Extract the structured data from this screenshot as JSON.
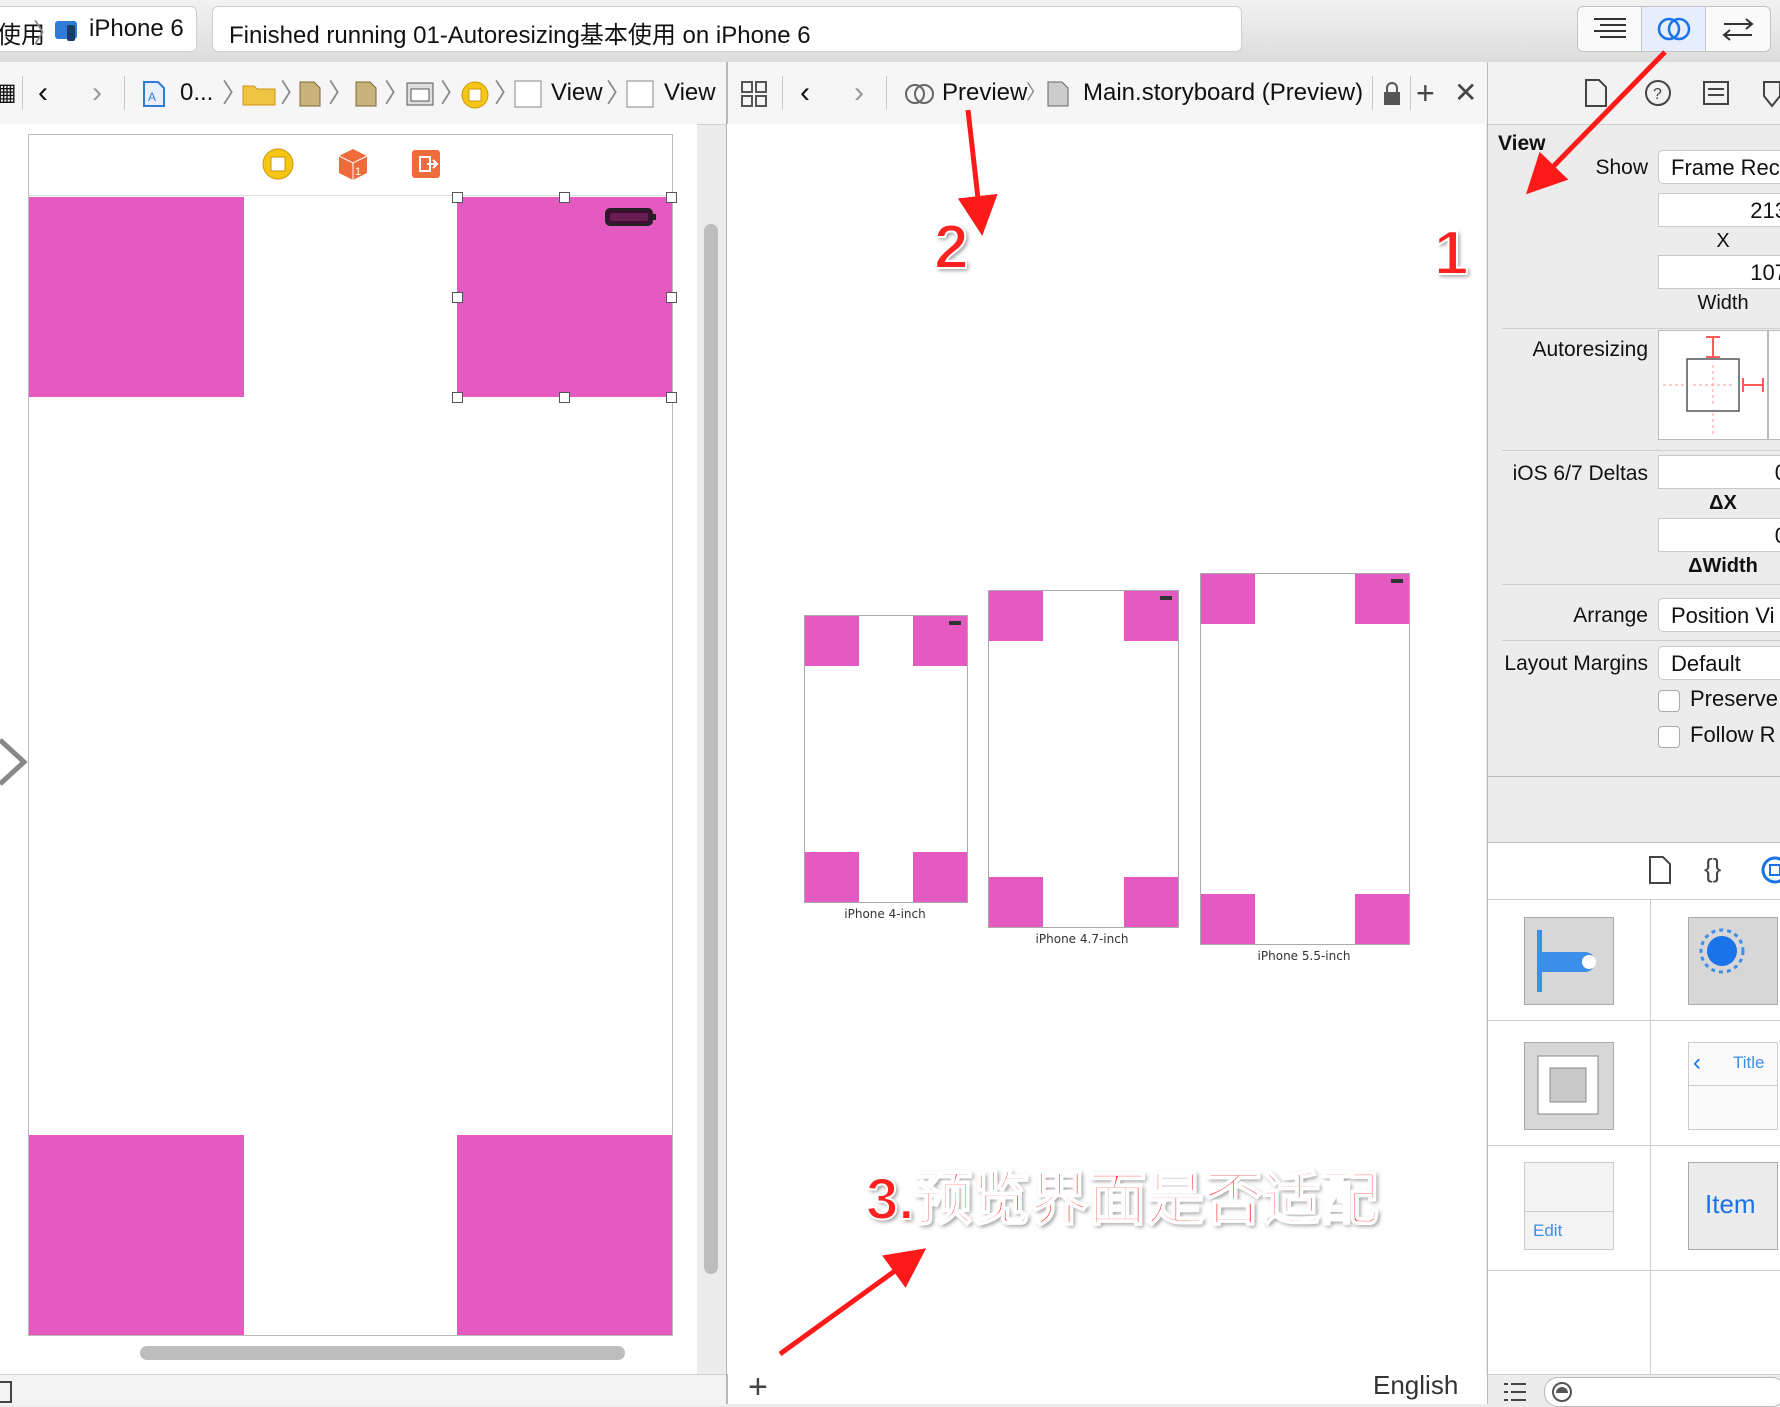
{
  "toolbar": {
    "scheme_prefix": "使用",
    "device": "iPhone 6",
    "status": "Finished running 01-Autoresizing基本使用 on iPhone 6"
  },
  "left_jumpbar": {
    "project": "0...",
    "view1": "View",
    "view2": "View"
  },
  "right_jumpbar": {
    "preview": "Preview",
    "file": "Main.storyboard (Preview)"
  },
  "preview": {
    "devices": [
      {
        "label": "iPhone 4-inch"
      },
      {
        "label": "iPhone 4.7-inch"
      },
      {
        "label": "iPhone 5.5-inch"
      }
    ],
    "language": "English"
  },
  "inspector": {
    "title": "View",
    "show_label": "Show",
    "show_value": "Frame Rec",
    "x_value": "213",
    "x_label": "X",
    "width_value": "107",
    "width_label": "Width",
    "autoresizing_label": "Autoresizing",
    "deltas_label": "iOS 6/7 Deltas",
    "dx_value": "0",
    "dx_label": "ΔX",
    "dwidth_value": "0",
    "dwidth_label": "ΔWidth",
    "arrange_label": "Arrange",
    "arrange_value": "Position Vi",
    "margins_label": "Layout Margins",
    "margins_value": "Default",
    "preserve_label": "Preserve",
    "follow_label": "Follow R"
  },
  "library": {
    "title_item": "Title",
    "edit_item": "Edit",
    "item_item": "Item"
  },
  "annotations": {
    "one": "1",
    "two": "2",
    "three": "3.预览界面是否适配"
  },
  "colors": {
    "magenta": "#e45ac1",
    "accent": "#1a73e8",
    "annotation": "#ff2020"
  }
}
